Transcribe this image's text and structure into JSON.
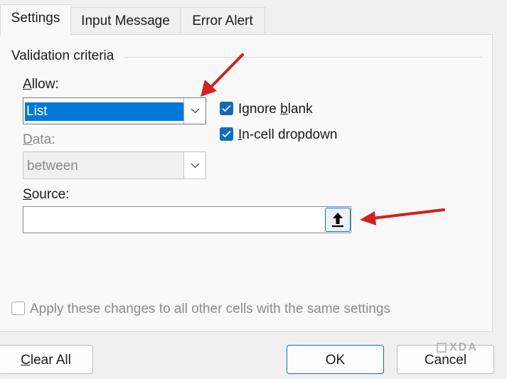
{
  "tabs": [
    {
      "label": "Settings"
    },
    {
      "label": "Input Message"
    },
    {
      "label": "Error Alert"
    }
  ],
  "criteria": {
    "group_label": "Validation criteria",
    "allow_label": "Allow:",
    "allow_value": "List",
    "data_label": "Data:",
    "data_value": "between",
    "source_label": "Source:",
    "source_value": ""
  },
  "options": {
    "ignore_blank": {
      "label": "Ignore blank",
      "checked": true
    },
    "in_cell_dropdown": {
      "label": "In-cell dropdown",
      "checked": true
    }
  },
  "apply_all": {
    "label": "Apply these changes to all other cells with the same settings",
    "checked": false
  },
  "buttons": {
    "clear_all": "Clear All",
    "ok": "OK",
    "cancel": "Cancel"
  },
  "watermark": "XDA",
  "colors": {
    "accent": "#0f6cbd",
    "selection": "#0078d7",
    "annotation_arrow": "#d42020"
  }
}
